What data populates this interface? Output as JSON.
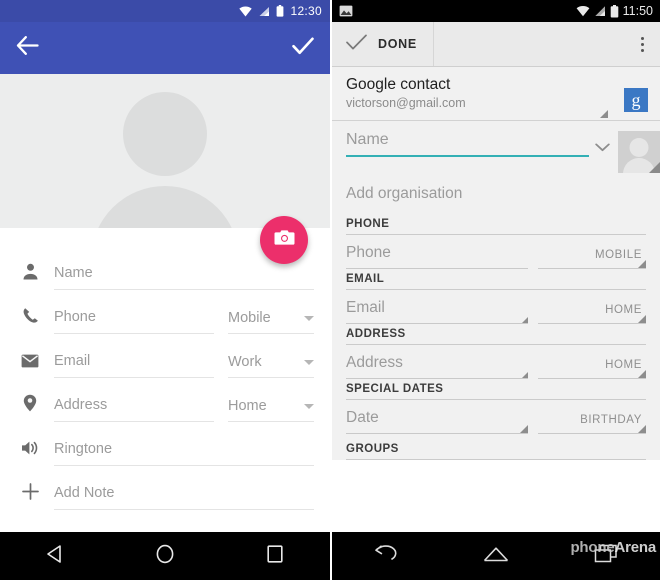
{
  "left_phone": {
    "status_bar": {
      "time": "12:30",
      "icons": [
        "wifi-icon",
        "signal-icon",
        "battery-icon"
      ],
      "bg_color": "#3b4ba8"
    },
    "toolbar": {
      "back_label": "back-arrow",
      "confirm_label": "check",
      "bg_color": "#3f51b5"
    },
    "hero": {
      "avatar_placeholder": "person-placeholder"
    },
    "fab": {
      "icon": "camera-icon",
      "color": "#ec2f6b"
    },
    "fields": [
      {
        "icon": "person-icon",
        "label": "Name",
        "type": null
      },
      {
        "icon": "phone-icon",
        "label": "Phone",
        "type": "Mobile"
      },
      {
        "icon": "email-icon",
        "label": "Email",
        "type": "Work"
      },
      {
        "icon": "location-icon",
        "label": "Address",
        "type": "Home"
      },
      {
        "icon": "speaker-icon",
        "label": "Ringtone",
        "type": null
      },
      {
        "icon": "plus-icon",
        "label": "Add Note",
        "type": null
      }
    ],
    "nav": {
      "back": "triangle-back-icon",
      "home": "circle-home-icon",
      "recents": "square-recents-icon"
    }
  },
  "right_phone": {
    "status_bar": {
      "time": "11:50",
      "icons": [
        "gallery-icon",
        "wifi-icon",
        "signal-icon",
        "battery-icon"
      ],
      "bg_color": "#000000"
    },
    "action_bar": {
      "done_label": "DONE",
      "done_icon": "check-icon",
      "overflow_icon": "overflow-menu-icon"
    },
    "account": {
      "title": "Google contact",
      "email": "victorson@gmail.com",
      "badge": "g",
      "badge_color": "#3b78c4"
    },
    "name_row": {
      "label": "Name",
      "chevron": "chevron-down-icon",
      "avatar": "person-placeholder",
      "underline_color": "#33b0b5"
    },
    "organisation": {
      "label": "Add organisation"
    },
    "sections": [
      {
        "header": "PHONE",
        "field_label": "Phone",
        "type_label": "MOBILE",
        "left_tri": false
      },
      {
        "header": "EMAIL",
        "field_label": "Email",
        "type_label": "HOME",
        "left_tri": true
      },
      {
        "header": "ADDRESS",
        "field_label": "Address",
        "type_label": "HOME",
        "left_tri": true
      },
      {
        "header": "SPECIAL DATES",
        "field_label": "Date",
        "type_label": "BIRTHDAY",
        "left_tri": true
      },
      {
        "header": "GROUPS",
        "field_label": null,
        "type_label": null,
        "left_tri": false
      }
    ],
    "nav": {
      "back": "back-arrow-icon",
      "home": "home-icon",
      "recents": "recents-icon"
    },
    "watermark": {
      "part1": "phone",
      "part2": "Arena"
    }
  }
}
